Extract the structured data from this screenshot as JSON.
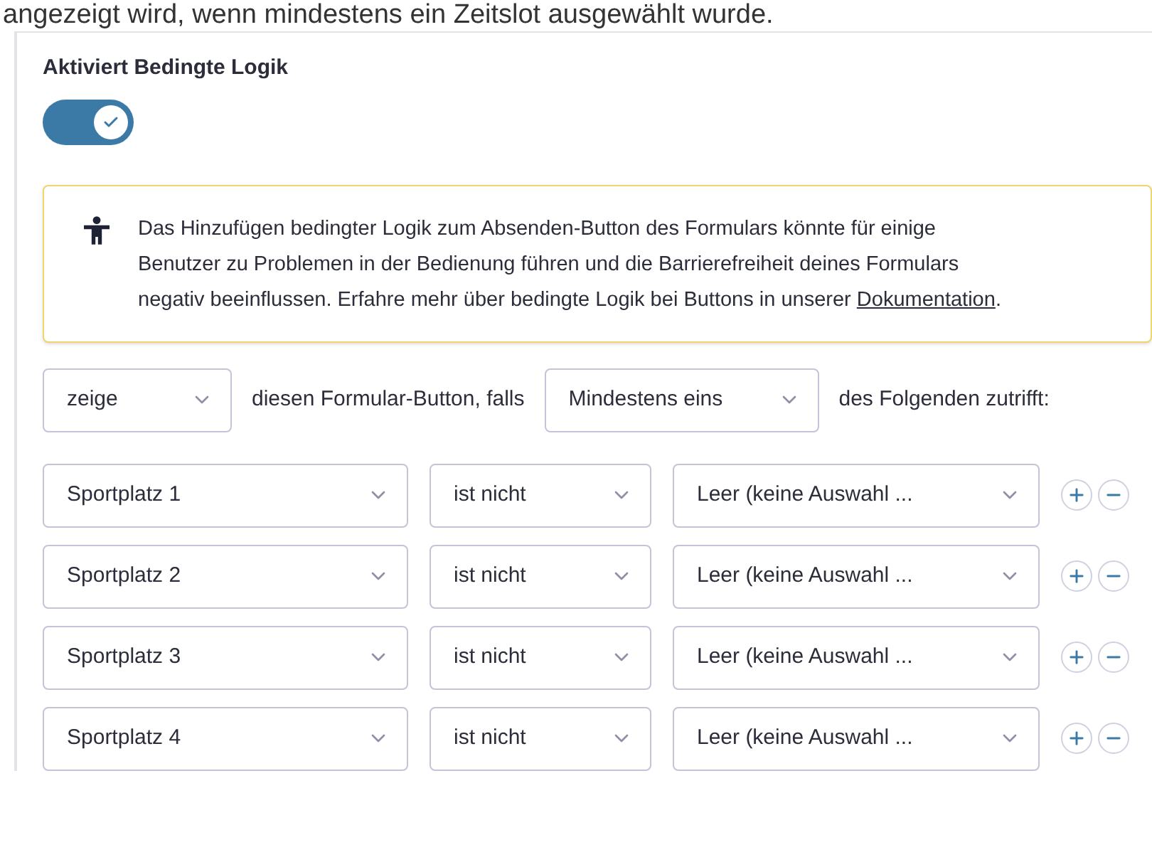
{
  "intro_text": "angezeigt wird, wenn mindestens ein Zeitslot ausgewählt wurde.",
  "toggle": {
    "label": "Aktiviert Bedingte Logik",
    "on": true
  },
  "notice": {
    "text": "Das Hinzufügen bedingter Logik zum Absenden-Button des Formulars könnte für einige Benutzer zu Problemen in der Bedienung führen und die Barrierefreiheit deines Formulars negativ beeinflussen. Erfahre mehr über bedingte Logik bei Buttons in unserer",
    "link": "Dokumentation",
    "after": "."
  },
  "rule": {
    "action": "zeige",
    "text_1": "diesen Formular-Button, falls",
    "match": "Mindestens eins",
    "text_2": "des Folgenden zutrifft:"
  },
  "conditions": [
    {
      "field": "Sportplatz 1",
      "operator": "ist nicht",
      "value": "Leer (keine Auswahl ..."
    },
    {
      "field": "Sportplatz 2",
      "operator": "ist nicht",
      "value": "Leer (keine Auswahl ..."
    },
    {
      "field": "Sportplatz 3",
      "operator": "ist nicht",
      "value": "Leer (keine Auswahl ..."
    },
    {
      "field": "Sportplatz 4",
      "operator": "ist nicht",
      "value": "Leer (keine Auswahl ..."
    }
  ]
}
